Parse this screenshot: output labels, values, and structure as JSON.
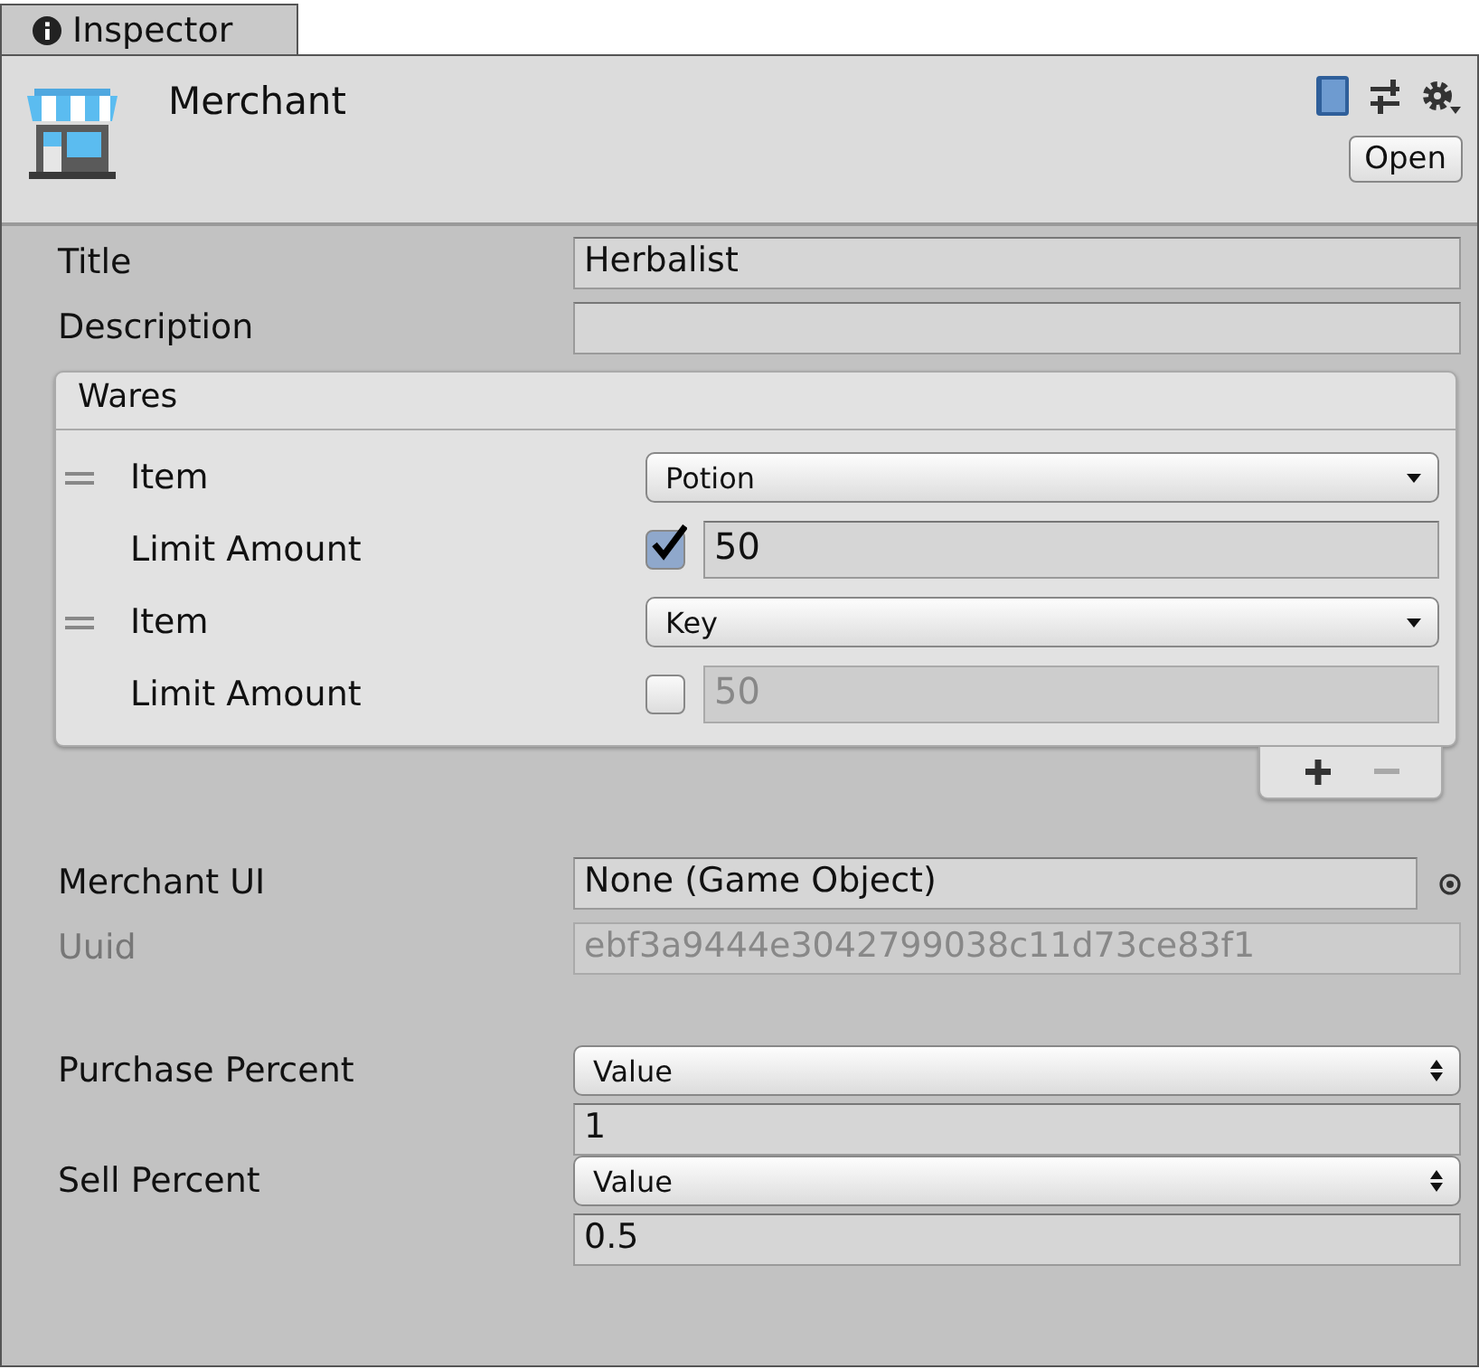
{
  "tab": {
    "label": "Inspector",
    "selected": true
  },
  "component": {
    "name": "Merchant",
    "open_button": "Open"
  },
  "groups": [
    {
      "fields": [
        {
          "kind": "text",
          "label": "Title",
          "value": "Herbalist",
          "disabled": false
        },
        {
          "kind": "text",
          "label": "Description",
          "disabled": false
        },
        {
          "kind": "list",
          "title": "Wares",
          "disabled": false,
          "items": [
            {
              "item_label": "Item",
              "item_value": "Potion",
              "limit_label": "Limit Amount",
              "limit_checked": true,
              "limit_value": "50"
            },
            {
              "item_label": "Item",
              "item_value": "Key",
              "limit_label": "Limit Amount",
              "limit_checked": false,
              "limit_value": "50"
            }
          ]
        }
      ]
    },
    {
      "fields": [
        {
          "kind": "object",
          "label": "Merchant UI",
          "value": "None (Game Object)",
          "disabled": false
        },
        {
          "kind": "text",
          "label": "Uuid",
          "value": "ebf3a9444e3042799038c11d73ce83f1",
          "disabled": true
        }
      ]
    },
    {
      "fields": [
        {
          "kind": "mode",
          "label": "Purchase Percent",
          "mode": "Value",
          "value": "1",
          "disabled": false
        },
        {
          "kind": "mode",
          "label": "Sell Percent",
          "mode": "Value",
          "value": "0.5",
          "disabled": false
        }
      ]
    }
  ]
}
